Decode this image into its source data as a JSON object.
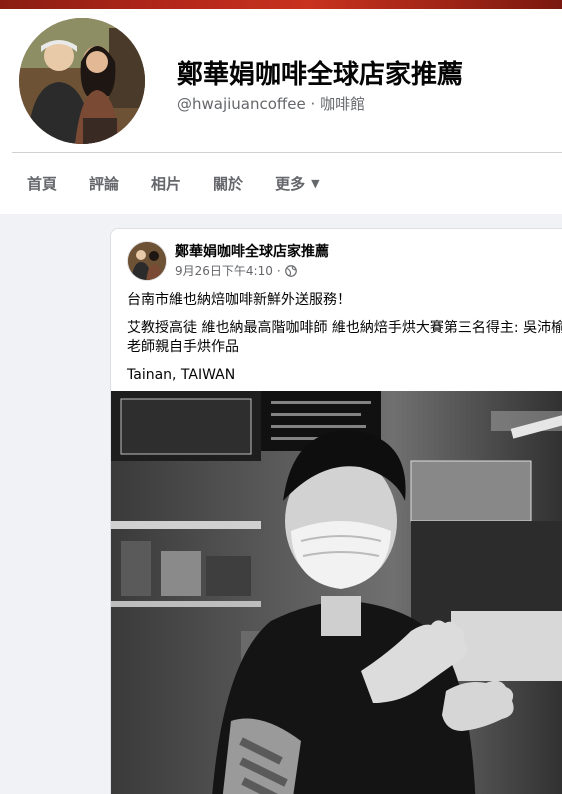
{
  "page": {
    "name": "鄭華娟咖啡全球店家推薦",
    "handle": "@hwajiuancoffee",
    "category": "咖啡館",
    "separator": "·"
  },
  "tabs": [
    {
      "label": "首頁"
    },
    {
      "label": "評論"
    },
    {
      "label": "相片"
    },
    {
      "label": "關於"
    },
    {
      "label": "更多"
    }
  ],
  "post": {
    "author": "鄭華娟咖啡全球店家推薦",
    "date": "9月26日下午4:10",
    "meta_separator": "·",
    "privacy_icon": "globe-icon",
    "lines": [
      "台南市維也納焙咖啡新鮮外送服務！",
      "艾教授高徒 維也納最高階咖啡師 維也納焙手烘大賽第三名得主: 吳沛榆老師親自手烘作品",
      "Tainan, TAIWAN"
    ]
  },
  "colors": {
    "cover_red": "#b3261a",
    "text_primary": "#050505",
    "text_secondary": "#65676b",
    "background": "#f0f2f5"
  }
}
